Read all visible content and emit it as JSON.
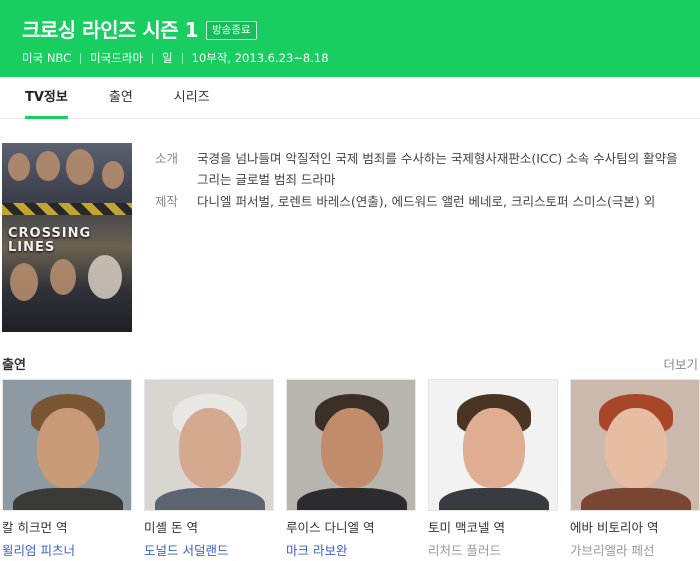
{
  "header": {
    "title": "크로싱 라인즈 시즌 1",
    "badge": "방송종료",
    "meta": [
      "미국 NBC",
      "미국드라마",
      "일",
      "10부작, 2013.6.23~8.18"
    ]
  },
  "tabs": [
    {
      "label": "TV정보",
      "active": true
    },
    {
      "label": "출연",
      "active": false
    },
    {
      "label": "시리즈",
      "active": false
    }
  ],
  "poster": {
    "logo_line1": "CROSSING",
    "logo_line2": "LINES"
  },
  "info": {
    "intro_label": "소개",
    "intro_text": "국경을 넘나들며 악질적인 국제 범죄를 수사하는 국제형사재판소(ICC) 소속 수사팀의 활약을 그리는 글로벌 범죄 드라마",
    "prod_label": "제작",
    "prod_text": "다니엘 퍼서벌, 로렌트 바레스(연출), 에드워드 앨런 베네로, 크리스토퍼 스미스(극본) 외"
  },
  "cast_section": {
    "title": "출연",
    "more": "더보기",
    "members": [
      {
        "role": "칼 히크먼 역",
        "actor": "윌리엄 피츠너",
        "linked": true
      },
      {
        "role": "미셸 돈 역",
        "actor": "도널드 서덜랜드",
        "linked": true
      },
      {
        "role": "루이스 다니엘 역",
        "actor": "마크 라보완",
        "linked": true
      },
      {
        "role": "토미 맥코넬 역",
        "actor": "리처드 플러드",
        "linked": false
      },
      {
        "role": "에바 비토리아 역",
        "actor": "가브리엘라 페선",
        "linked": false
      }
    ]
  },
  "colors": {
    "accent": "#19ce60",
    "link": "#3b5fd6"
  }
}
